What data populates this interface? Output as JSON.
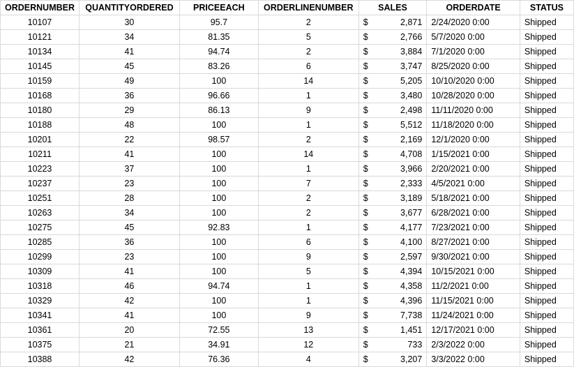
{
  "headers": {
    "ordernumber": "ORDERNUMBER",
    "quantityordered": "QUANTITYORDERED",
    "priceeach": "PRICEEACH",
    "orderlinenumber": "ORDERLINENUMBER",
    "sales": "SALES",
    "orderdate": "ORDERDATE",
    "status": "STATUS"
  },
  "sales_currency_symbol": "$",
  "rows": [
    {
      "ordernumber": "10107",
      "quantityordered": "30",
      "priceeach": "95.7",
      "orderlinenumber": "2",
      "sales": "2,871",
      "orderdate": "2/24/2020 0:00",
      "status": "Shipped"
    },
    {
      "ordernumber": "10121",
      "quantityordered": "34",
      "priceeach": "81.35",
      "orderlinenumber": "5",
      "sales": "2,766",
      "orderdate": "5/7/2020 0:00",
      "status": "Shipped"
    },
    {
      "ordernumber": "10134",
      "quantityordered": "41",
      "priceeach": "94.74",
      "orderlinenumber": "2",
      "sales": "3,884",
      "orderdate": "7/1/2020 0:00",
      "status": "Shipped"
    },
    {
      "ordernumber": "10145",
      "quantityordered": "45",
      "priceeach": "83.26",
      "orderlinenumber": "6",
      "sales": "3,747",
      "orderdate": "8/25/2020 0:00",
      "status": "Shipped"
    },
    {
      "ordernumber": "10159",
      "quantityordered": "49",
      "priceeach": "100",
      "orderlinenumber": "14",
      "sales": "5,205",
      "orderdate": "10/10/2020 0:00",
      "status": "Shipped"
    },
    {
      "ordernumber": "10168",
      "quantityordered": "36",
      "priceeach": "96.66",
      "orderlinenumber": "1",
      "sales": "3,480",
      "orderdate": "10/28/2020 0:00",
      "status": "Shipped"
    },
    {
      "ordernumber": "10180",
      "quantityordered": "29",
      "priceeach": "86.13",
      "orderlinenumber": "9",
      "sales": "2,498",
      "orderdate": "11/11/2020 0:00",
      "status": "Shipped"
    },
    {
      "ordernumber": "10188",
      "quantityordered": "48",
      "priceeach": "100",
      "orderlinenumber": "1",
      "sales": "5,512",
      "orderdate": "11/18/2020 0:00",
      "status": "Shipped"
    },
    {
      "ordernumber": "10201",
      "quantityordered": "22",
      "priceeach": "98.57",
      "orderlinenumber": "2",
      "sales": "2,169",
      "orderdate": "12/1/2020 0:00",
      "status": "Shipped"
    },
    {
      "ordernumber": "10211",
      "quantityordered": "41",
      "priceeach": "100",
      "orderlinenumber": "14",
      "sales": "4,708",
      "orderdate": "1/15/2021 0:00",
      "status": "Shipped"
    },
    {
      "ordernumber": "10223",
      "quantityordered": "37",
      "priceeach": "100",
      "orderlinenumber": "1",
      "sales": "3,966",
      "orderdate": "2/20/2021 0:00",
      "status": "Shipped"
    },
    {
      "ordernumber": "10237",
      "quantityordered": "23",
      "priceeach": "100",
      "orderlinenumber": "7",
      "sales": "2,333",
      "orderdate": "4/5/2021 0:00",
      "status": "Shipped"
    },
    {
      "ordernumber": "10251",
      "quantityordered": "28",
      "priceeach": "100",
      "orderlinenumber": "2",
      "sales": "3,189",
      "orderdate": "5/18/2021 0:00",
      "status": "Shipped"
    },
    {
      "ordernumber": "10263",
      "quantityordered": "34",
      "priceeach": "100",
      "orderlinenumber": "2",
      "sales": "3,677",
      "orderdate": "6/28/2021 0:00",
      "status": "Shipped"
    },
    {
      "ordernumber": "10275",
      "quantityordered": "45",
      "priceeach": "92.83",
      "orderlinenumber": "1",
      "sales": "4,177",
      "orderdate": "7/23/2021 0:00",
      "status": "Shipped"
    },
    {
      "ordernumber": "10285",
      "quantityordered": "36",
      "priceeach": "100",
      "orderlinenumber": "6",
      "sales": "4,100",
      "orderdate": "8/27/2021 0:00",
      "status": "Shipped"
    },
    {
      "ordernumber": "10299",
      "quantityordered": "23",
      "priceeach": "100",
      "orderlinenumber": "9",
      "sales": "2,597",
      "orderdate": "9/30/2021 0:00",
      "status": "Shipped"
    },
    {
      "ordernumber": "10309",
      "quantityordered": "41",
      "priceeach": "100",
      "orderlinenumber": "5",
      "sales": "4,394",
      "orderdate": "10/15/2021 0:00",
      "status": "Shipped"
    },
    {
      "ordernumber": "10318",
      "quantityordered": "46",
      "priceeach": "94.74",
      "orderlinenumber": "1",
      "sales": "4,358",
      "orderdate": "11/2/2021 0:00",
      "status": "Shipped"
    },
    {
      "ordernumber": "10329",
      "quantityordered": "42",
      "priceeach": "100",
      "orderlinenumber": "1",
      "sales": "4,396",
      "orderdate": "11/15/2021 0:00",
      "status": "Shipped"
    },
    {
      "ordernumber": "10341",
      "quantityordered": "41",
      "priceeach": "100",
      "orderlinenumber": "9",
      "sales": "7,738",
      "orderdate": "11/24/2021 0:00",
      "status": "Shipped"
    },
    {
      "ordernumber": "10361",
      "quantityordered": "20",
      "priceeach": "72.55",
      "orderlinenumber": "13",
      "sales": "1,451",
      "orderdate": "12/17/2021 0:00",
      "status": "Shipped"
    },
    {
      "ordernumber": "10375",
      "quantityordered": "21",
      "priceeach": "34.91",
      "orderlinenumber": "12",
      "sales": "733",
      "orderdate": "2/3/2022 0:00",
      "status": "Shipped"
    },
    {
      "ordernumber": "10388",
      "quantityordered": "42",
      "priceeach": "76.36",
      "orderlinenumber": "4",
      "sales": "3,207",
      "orderdate": "3/3/2022 0:00",
      "status": "Shipped"
    }
  ]
}
